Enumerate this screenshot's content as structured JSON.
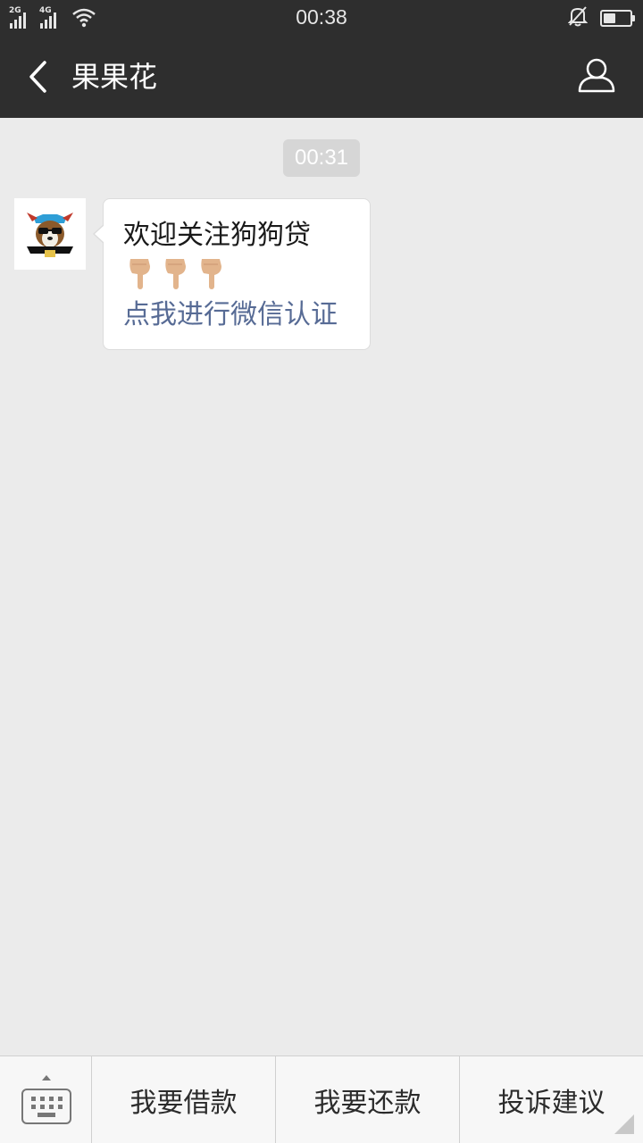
{
  "status_bar": {
    "time": "00:38",
    "sim1_label": "2G",
    "sim2_label": "4G",
    "battery_level": 0.45
  },
  "header": {
    "title": "果果花"
  },
  "chat": {
    "timestamp": "00:31",
    "message": {
      "line1": "欢迎关注狗狗贷",
      "emoji": [
        "👇",
        "👇",
        "👇"
      ],
      "link_text": "点我进行微信认证"
    }
  },
  "bottom_menu": {
    "items": [
      {
        "label": "我要借款"
      },
      {
        "label": "我要还款"
      },
      {
        "label": "投诉建议"
      }
    ]
  },
  "colors": {
    "bar_bg": "#2e2e2e",
    "chat_bg": "#ebebeb",
    "link": "#576b95"
  }
}
